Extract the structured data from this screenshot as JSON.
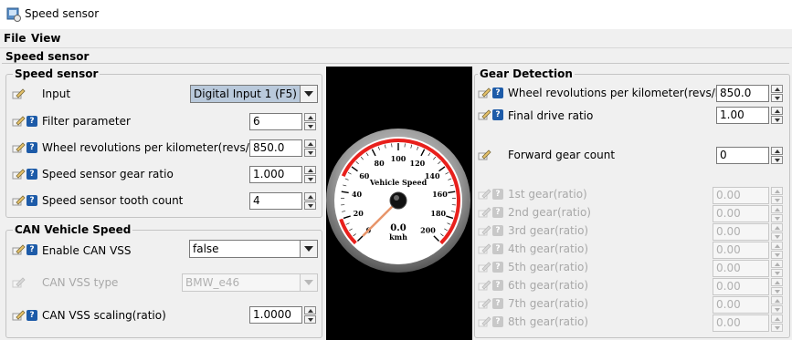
{
  "window": {
    "title": "Speed sensor"
  },
  "menu": {
    "file": "File",
    "view": "View"
  },
  "panel_title": "Speed sensor",
  "speed_sensor": {
    "title": "Speed sensor",
    "input_label": "Input",
    "input_value": "Digital Input 1 (F5)",
    "filter_label": "Filter parameter",
    "filter_value": "6",
    "wheel_rev_label": "Wheel revolutions per kilometer(revs/km)",
    "wheel_rev_value": "850.0",
    "gear_ratio_label": "Speed sensor gear ratio",
    "gear_ratio_value": "1.000",
    "tooth_count_label": "Speed sensor tooth count",
    "tooth_count_value": "4"
  },
  "can_vss": {
    "title": "CAN Vehicle Speed",
    "enable_label": "Enable CAN VSS",
    "enable_value": "false",
    "type_label": "CAN VSS type",
    "type_value": "BMW_e46",
    "scaling_label": "CAN VSS scaling(ratio)",
    "scaling_value": "1.0000"
  },
  "gauge": {
    "title": "Vehicle Speed",
    "value": "0.0",
    "unit": "kmh",
    "ticks": [
      "0",
      "20",
      "40",
      "60",
      "80",
      "100",
      "120",
      "140",
      "160",
      "180",
      "200"
    ],
    "redline_start": 140,
    "max": 200,
    "current": 0
  },
  "gear_detection": {
    "title": "Gear Detection",
    "wheel_rev_label": "Wheel revolutions per kilometer(revs/km)",
    "wheel_rev_value": "850.0",
    "final_drive_label": "Final drive ratio",
    "final_drive_value": "1.00",
    "forward_count_label": "Forward gear count",
    "forward_count_value": "0",
    "gears": [
      {
        "label": "1st gear(ratio)",
        "value": "0.00"
      },
      {
        "label": "2nd gear(ratio)",
        "value": "0.00"
      },
      {
        "label": "3rd gear(ratio)",
        "value": "0.00"
      },
      {
        "label": "4th gear(ratio)",
        "value": "0.00"
      },
      {
        "label": "5th gear(ratio)",
        "value": "0.00"
      },
      {
        "label": "6th gear(ratio)",
        "value": "0.00"
      },
      {
        "label": "7th gear(ratio)",
        "value": "0.00"
      },
      {
        "label": "8th gear(ratio)",
        "value": "0.00"
      }
    ]
  },
  "colors": {
    "accent_red": "#e8201c",
    "help_blue": "#1d5ba8",
    "selected_combo": "#b9c9db"
  }
}
